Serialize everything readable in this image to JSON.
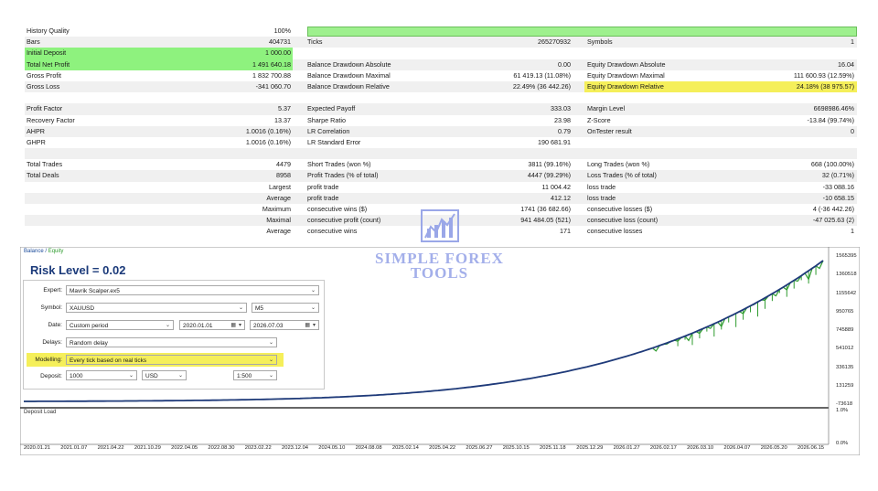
{
  "report": {
    "history_quality_label": "History Quality",
    "history_quality_value": "100%",
    "bars_label": "Bars",
    "bars_value": "404731",
    "ticks_label": "Ticks",
    "ticks_value": "265270932",
    "symbols_label": "Symbols",
    "symbols_value": "1",
    "initial_deposit_label": "Initial Deposit",
    "initial_deposit_value": "1 000.00",
    "total_net_profit_label": "Total Net Profit",
    "total_net_profit_value": "1 491 640.18",
    "bal_dd_abs_label": "Balance Drawdown Absolute",
    "bal_dd_abs_value": "0.00",
    "eq_dd_abs_label": "Equity Drawdown Absolute",
    "eq_dd_abs_value": "16.04",
    "gross_profit_label": "Gross Profit",
    "gross_profit_value": "1 832 700.88",
    "bal_dd_max_label": "Balance Drawdown Maximal",
    "bal_dd_max_value": "61 419.13 (11.08%)",
    "eq_dd_max_label": "Equity Drawdown Maximal",
    "eq_dd_max_value": "111 600.93 (12.59%)",
    "gross_loss_label": "Gross Loss",
    "gross_loss_value": "-341 060.70",
    "bal_dd_rel_label": "Balance Drawdown Relative",
    "bal_dd_rel_value": "22.49% (36 442.26)",
    "eq_dd_rel_label": "Equity Drawdown Relative",
    "eq_dd_rel_value": "24.18% (38 975.57)",
    "profit_factor_label": "Profit Factor",
    "profit_factor_value": "5.37",
    "expected_payoff_label": "Expected Payoff",
    "expected_payoff_value": "333.03",
    "margin_level_label": "Margin Level",
    "margin_level_value": "6698986.46%",
    "recovery_factor_label": "Recovery Factor",
    "recovery_factor_value": "13.37",
    "sharpe_label": "Sharpe Ratio",
    "sharpe_value": "23.98",
    "zscore_label": "Z-Score",
    "zscore_value": "-13.84 (99.74%)",
    "ahpr_label": "AHPR",
    "ahpr_value": "1.0016 (0.16%)",
    "lr_corr_label": "LR Correlation",
    "lr_corr_value": "0.79",
    "ontester_label": "OnTester result",
    "ontester_value": "0",
    "ghpr_label": "GHPR",
    "ghpr_value": "1.0016 (0.16%)",
    "lr_std_label": "LR Standard Error",
    "lr_std_value": "190 681.91",
    "total_trades_label": "Total Trades",
    "total_trades_value": "4479",
    "short_trades_label": "Short Trades (won %)",
    "short_trades_value": "3811 (99.16%)",
    "long_trades_label": "Long Trades (won %)",
    "long_trades_value": "668 (100.00%)",
    "total_deals_label": "Total Deals",
    "total_deals_value": "8958",
    "profit_trades_label": "Profit Trades (% of total)",
    "profit_trades_value": "4447 (99.29%)",
    "loss_trades_label": "Loss Trades (% of total)",
    "loss_trades_value": "32 (0.71%)",
    "largest_label": "Largest",
    "largest_profit_label": "profit trade",
    "largest_profit_value": "11 004.42",
    "largest_loss_label": "loss trade",
    "largest_loss_value": "-33 088.16",
    "average_label": "Average",
    "average_profit_label": "profit trade",
    "average_profit_value": "412.12",
    "average_loss_label": "loss trade",
    "average_loss_value": "-10 658.15",
    "maximum_label": "Maximum",
    "max_cons_wins_label": "consecutive wins ($)",
    "max_cons_wins_value": "1741 (36 682.66)",
    "max_cons_losses_label": "consecutive losses ($)",
    "max_cons_losses_value": "4 (-36 442.26)",
    "maximal_label": "Maximal",
    "maximal_cons_profit_label": "consecutive profit (count)",
    "maximal_cons_profit_value": "941 484.05 (521)",
    "maximal_cons_loss_label": "consecutive loss (count)",
    "maximal_cons_loss_value": "-47 025.63 (2)",
    "average2_label": "Average",
    "avg_cons_wins_label": "consecutive wins",
    "avg_cons_wins_value": "171",
    "avg_cons_losses_label": "consecutive losses",
    "avg_cons_losses_value": "1"
  },
  "chart": {
    "title_balance": "Balance",
    "title_sep": " / ",
    "title_equity": "Equity",
    "sub_title": "Deposit Load",
    "y_labels": [
      "1565395",
      "1360518",
      "1155642",
      "950765",
      "745889",
      "541012",
      "336135",
      "131259",
      "-73618"
    ],
    "sub_y_labels": [
      "1.0%",
      "0.0%"
    ],
    "x_labels": [
      "2020.01.21",
      "2021.01.07",
      "2021.04.22",
      "2021.10.29",
      "2022.04.05",
      "2022.08.30",
      "2023.02.22",
      "2023.12.04",
      "2024.05.10",
      "2024.08.08",
      "2025.02.14",
      "2025.04.22",
      "2025.06.27",
      "2025.10.15",
      "2025.11.18",
      "2025.12.29",
      "2026.01.27",
      "2026.02.17",
      "2026.03.10",
      "2026.04.07",
      "2026.05.20",
      "2026.06.15"
    ],
    "line_color": "#1f3a7a",
    "equity_color": "#2e9b2e"
  },
  "settings": {
    "risk_level": "Risk Level = 0.02",
    "expert_label": "Expert:",
    "expert_value": "Mavrik Scalper.ex5",
    "symbol_label": "Symbol:",
    "symbol_value": "XAUUSD",
    "timeframe_value": "M5",
    "date_label": "Date:",
    "date_mode": "Custom period",
    "date_from": "2020.01.01",
    "date_to": "2026.07.03",
    "delays_label": "Delays:",
    "delays_value": "Random delay",
    "modelling_label": "Modelling:",
    "modelling_value": "Every tick based on real ticks",
    "deposit_label": "Deposit:",
    "deposit_value": "1000",
    "currency_value": "USD",
    "leverage_value": "1:500"
  },
  "watermark": {
    "line1": "SIMPLE FOREX",
    "line2": "TOOLS"
  },
  "colors": {
    "highlight_green": "#8ef27e",
    "highlight_yellow": "#f5ef5a"
  }
}
